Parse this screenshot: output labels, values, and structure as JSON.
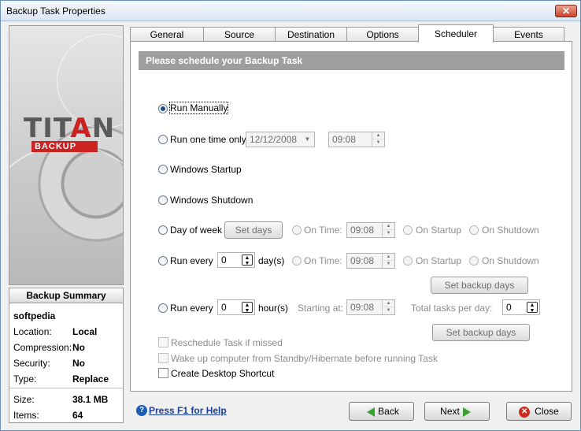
{
  "window": {
    "title": "Backup Task Properties"
  },
  "logo": {
    "brand_main": "TIT",
    "brand_a": "A",
    "brand_end": "N",
    "brand_sub": "BACKUP"
  },
  "summary": {
    "header": "Backup Summary",
    "name": "softpedia",
    "rows": [
      {
        "key": "Location:",
        "value": "Local"
      },
      {
        "key": "Compression:",
        "value": "No"
      },
      {
        "key": "Security:",
        "value": "No"
      },
      {
        "key": "Type:",
        "value": "Replace"
      },
      {
        "key": "Size:",
        "value": "38.1 MB"
      },
      {
        "key": "Items:",
        "value": "64"
      }
    ]
  },
  "tabs": [
    "General",
    "Source",
    "Destination",
    "Options",
    "Scheduler",
    "Events"
  ],
  "active_tab": "Scheduler",
  "scheduler": {
    "banner": "Please schedule your Backup Task",
    "run_manually": "Run Manually",
    "run_one_time": "Run one time only:",
    "one_time_date": "12/12/2008",
    "one_time_time": "09:08",
    "windows_startup": "Windows Startup",
    "windows_shutdown": "Windows Shutdown",
    "day_of_week": "Day of week",
    "set_days": "Set days",
    "on_time": "On Time:",
    "dow_time": "09:08",
    "on_startup": "On Startup",
    "on_shutdown": "On Shutdown",
    "run_every": "Run every",
    "days_value": "0",
    "days_unit": "day(s)",
    "days_time": "09:08",
    "set_backup_days": "Set backup days",
    "hours_value": "0",
    "hours_unit": "hour(s)",
    "starting_at": "Starting at:",
    "start_time": "09:08",
    "total_tasks": "Total tasks per day:",
    "total_value": "0",
    "reschedule": "Reschedule Task if missed",
    "wake_up": "Wake up computer from Standby/Hibernate before running Task",
    "desktop_shortcut": "Create Desktop Shortcut"
  },
  "footer": {
    "help": "Press F1 for Help",
    "back": "Back",
    "next": "Next",
    "close": "Close"
  }
}
